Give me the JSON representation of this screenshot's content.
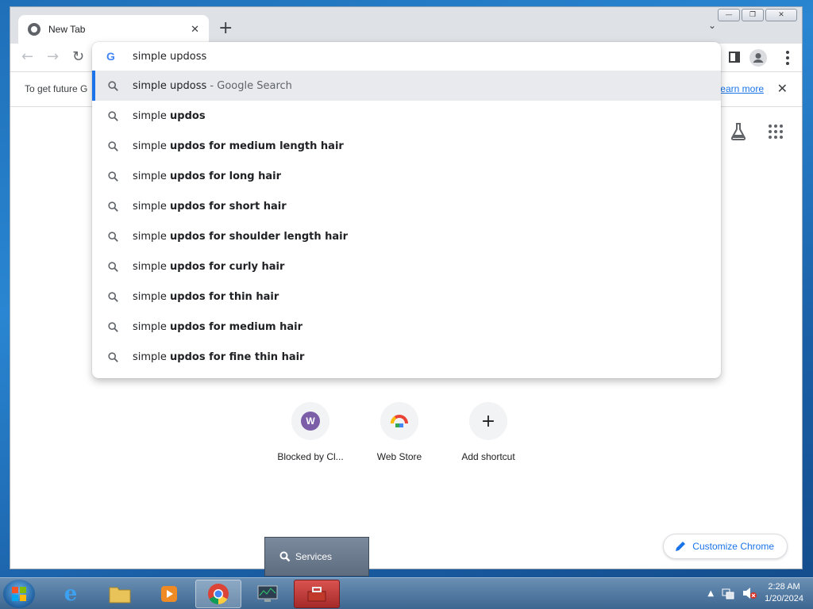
{
  "browser": {
    "tab": {
      "title": "New Tab"
    },
    "infobar": {
      "text": "To get future G",
      "link": "earn more"
    }
  },
  "omnibox": {
    "query": "simple updoss",
    "suggestions": [
      {
        "prefix": "simple updoss",
        "bold": "",
        "suffix": " - Google Search",
        "selected": true
      },
      {
        "prefix": "simple ",
        "bold": "updos",
        "suffix": ""
      },
      {
        "prefix": "simple ",
        "bold": "updos for medium length hair",
        "suffix": ""
      },
      {
        "prefix": "simple ",
        "bold": "updos for long hair",
        "suffix": ""
      },
      {
        "prefix": "simple ",
        "bold": "updos for short hair",
        "suffix": ""
      },
      {
        "prefix": "simple ",
        "bold": "updos for shoulder length hair",
        "suffix": ""
      },
      {
        "prefix": "simple ",
        "bold": "updos for curly hair",
        "suffix": ""
      },
      {
        "prefix": "simple ",
        "bold": "updos for thin hair",
        "suffix": ""
      },
      {
        "prefix": "simple ",
        "bold": "updos for medium hair",
        "suffix": ""
      },
      {
        "prefix": "simple ",
        "bold": "updos for fine thin hair",
        "suffix": ""
      }
    ]
  },
  "shortcuts": [
    {
      "label": "Blocked by Cl...",
      "icon": "W"
    },
    {
      "label": "Web Store",
      "icon": "web-store-icon"
    },
    {
      "label": "Add shortcut",
      "icon": "+"
    }
  ],
  "customize_label": "Customize Chrome",
  "services_popup": {
    "label": "Services"
  },
  "clock": {
    "time": "2:28 AM",
    "date": "1/20/2024"
  }
}
